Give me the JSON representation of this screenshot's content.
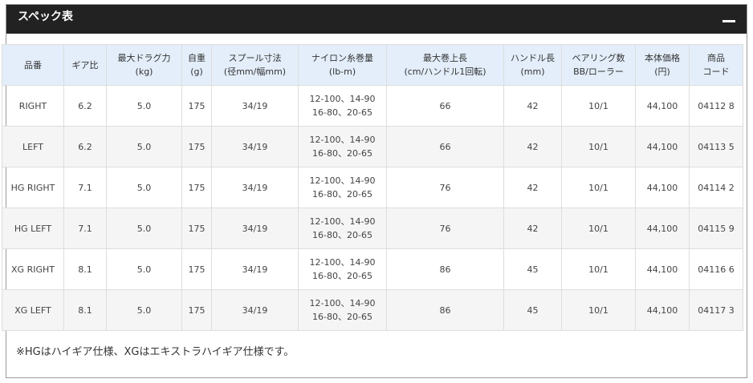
{
  "panel": {
    "title": "スペック表",
    "collapse_icon": "minus-icon"
  },
  "table": {
    "headers": [
      {
        "line1": "品番",
        "line2": ""
      },
      {
        "line1": "ギア比",
        "line2": ""
      },
      {
        "line1": "最大ドラグ力",
        "line2": "(kg)"
      },
      {
        "line1": "自重",
        "line2": "(g)"
      },
      {
        "line1": "スプール寸法",
        "line2": "(径mm/幅mm)"
      },
      {
        "line1": "ナイロン糸巻量",
        "line2": "(lb-m)"
      },
      {
        "line1": "最大巻上長",
        "line2": "(cm/ハンドル1回転)"
      },
      {
        "line1": "ハンドル長",
        "line2": "(mm)"
      },
      {
        "line1": "ベアリング数",
        "line2": "BB/ローラー"
      },
      {
        "line1": "本体価格",
        "line2": "(円)"
      },
      {
        "line1": "商品",
        "line2": "コード"
      }
    ],
    "rows": [
      {
        "model": "RIGHT",
        "gear": "6.2",
        "drag": "5.0",
        "weight": "175",
        "spool": "34/19",
        "line_a": "12-100、14-90",
        "line_b": "16-80、20-65",
        "retrieve": "66",
        "handle": "42",
        "bearing": "10/1",
        "price": "44,100",
        "code": "04112 8"
      },
      {
        "model": "LEFT",
        "gear": "6.2",
        "drag": "5.0",
        "weight": "175",
        "spool": "34/19",
        "line_a": "12-100、14-90",
        "line_b": "16-80、20-65",
        "retrieve": "66",
        "handle": "42",
        "bearing": "10/1",
        "price": "44,100",
        "code": "04113 5"
      },
      {
        "model": "HG RIGHT",
        "gear": "7.1",
        "drag": "5.0",
        "weight": "175",
        "spool": "34/19",
        "line_a": "12-100、14-90",
        "line_b": "16-80、20-65",
        "retrieve": "76",
        "handle": "42",
        "bearing": "10/1",
        "price": "44,100",
        "code": "04114 2"
      },
      {
        "model": "HG LEFT",
        "gear": "7.1",
        "drag": "5.0",
        "weight": "175",
        "spool": "34/19",
        "line_a": "12-100、14-90",
        "line_b": "16-80、20-65",
        "retrieve": "76",
        "handle": "42",
        "bearing": "10/1",
        "price": "44,100",
        "code": "04115 9"
      },
      {
        "model": "XG RIGHT",
        "gear": "8.1",
        "drag": "5.0",
        "weight": "175",
        "spool": "34/19",
        "line_a": "12-100、14-90",
        "line_b": "16-80、20-65",
        "retrieve": "86",
        "handle": "45",
        "bearing": "10/1",
        "price": "44,100",
        "code": "04116 6"
      },
      {
        "model": "XG LEFT",
        "gear": "8.1",
        "drag": "5.0",
        "weight": "175",
        "spool": "34/19",
        "line_a": "12-100、14-90",
        "line_b": "16-80、20-65",
        "retrieve": "86",
        "handle": "45",
        "bearing": "10/1",
        "price": "44,100",
        "code": "04117 3"
      }
    ]
  },
  "note": "※HGはハイギア仕様、XGはエキストラハイギア仕様です。"
}
